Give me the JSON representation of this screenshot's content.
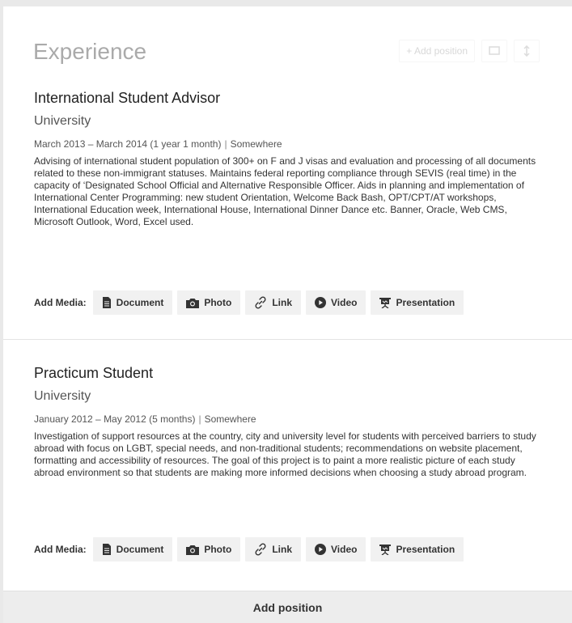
{
  "section": {
    "title": "Experience",
    "add_position_label": "+ Add position"
  },
  "media": {
    "label": "Add Media:",
    "buttons": [
      {
        "label": "Document",
        "icon": "document-icon"
      },
      {
        "label": "Photo",
        "icon": "camera-icon"
      },
      {
        "label": "Link",
        "icon": "link-icon"
      },
      {
        "label": "Video",
        "icon": "play-icon"
      },
      {
        "label": "Presentation",
        "icon": "presentation-icon"
      }
    ]
  },
  "entries": [
    {
      "title": "International Student Advisor",
      "organization": "University",
      "dates": "March 2013 – March 2014 (1 year 1 month)",
      "separator": "|",
      "location": "Somewhere",
      "description": "Advising of international student population of 300+ on F and J visas and evaluation and processing of all documents related to these non-immigrant statuses. Maintains federal reporting compliance through SEVIS (real time) in the capacity of ‘Designated School Official and Alternative Responsible Officer. Aids in planning and implementation of International Center Programming: new student Orientation, Welcome Back Bash, OPT/CPT/AT workshops, International Education week, International House, International Dinner Dance etc. Banner, Oracle, Web CMS, Microsoft Outlook, Word, Excel used."
    },
    {
      "title": "Practicum Student",
      "organization": "University",
      "dates": "January 2012 – May 2012 (5 months)",
      "separator": "|",
      "location": "Somewhere",
      "description": "Investigation of support resources at the country, city and university level for students with perceived barriers to study abroad with focus on LGBT, special needs, and non-traditional students; recommendations on website placement, formatting and accessibility of resources. The goal of this project is to paint a more realistic picture of each study abroad environment so that students are making more informed decisions when choosing a study abroad program."
    }
  ],
  "footer": {
    "add_position_label": "Add position"
  }
}
